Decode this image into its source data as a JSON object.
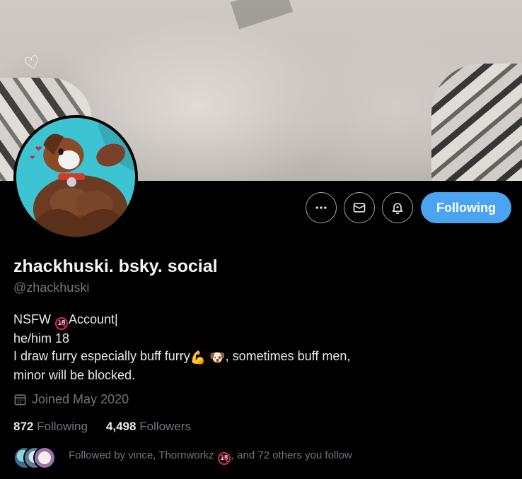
{
  "profile": {
    "display_name": "zhackhuski. bsky. social",
    "handle": "@zhackhuski",
    "bio": {
      "line1_prefix": "NSFW",
      "line1_badge": "18",
      "line1_suffix": "Account|",
      "line2": "he/him 18",
      "line3_prefix": "I draw furry especially buff furry",
      "line3_emoji1": "💪",
      "line3_emoji2": "🐶",
      "line3_suffix": ", sometimes buff men,",
      "line4": "minor will be blocked."
    },
    "joined": "Joined May 2020",
    "stats": {
      "following_count": "872",
      "following_label": "Following",
      "followers_count": "4,498",
      "followers_label": "Followers"
    },
    "followed_by": {
      "prefix": "Followed by vince, Thornworkz",
      "badge": "18",
      "suffix": ", and 72 others you follow"
    }
  },
  "actions": {
    "more_icon": "more-horizontal-icon",
    "message_icon": "envelope-icon",
    "notify_icon": "bell-icon",
    "follow_label": "Following"
  },
  "colors": {
    "background": "#000000",
    "primary_text": "#e7e9ea",
    "secondary_text": "#71767b",
    "follow_button": "#4aa4ef",
    "nsfw_badge": "#e0245e"
  }
}
